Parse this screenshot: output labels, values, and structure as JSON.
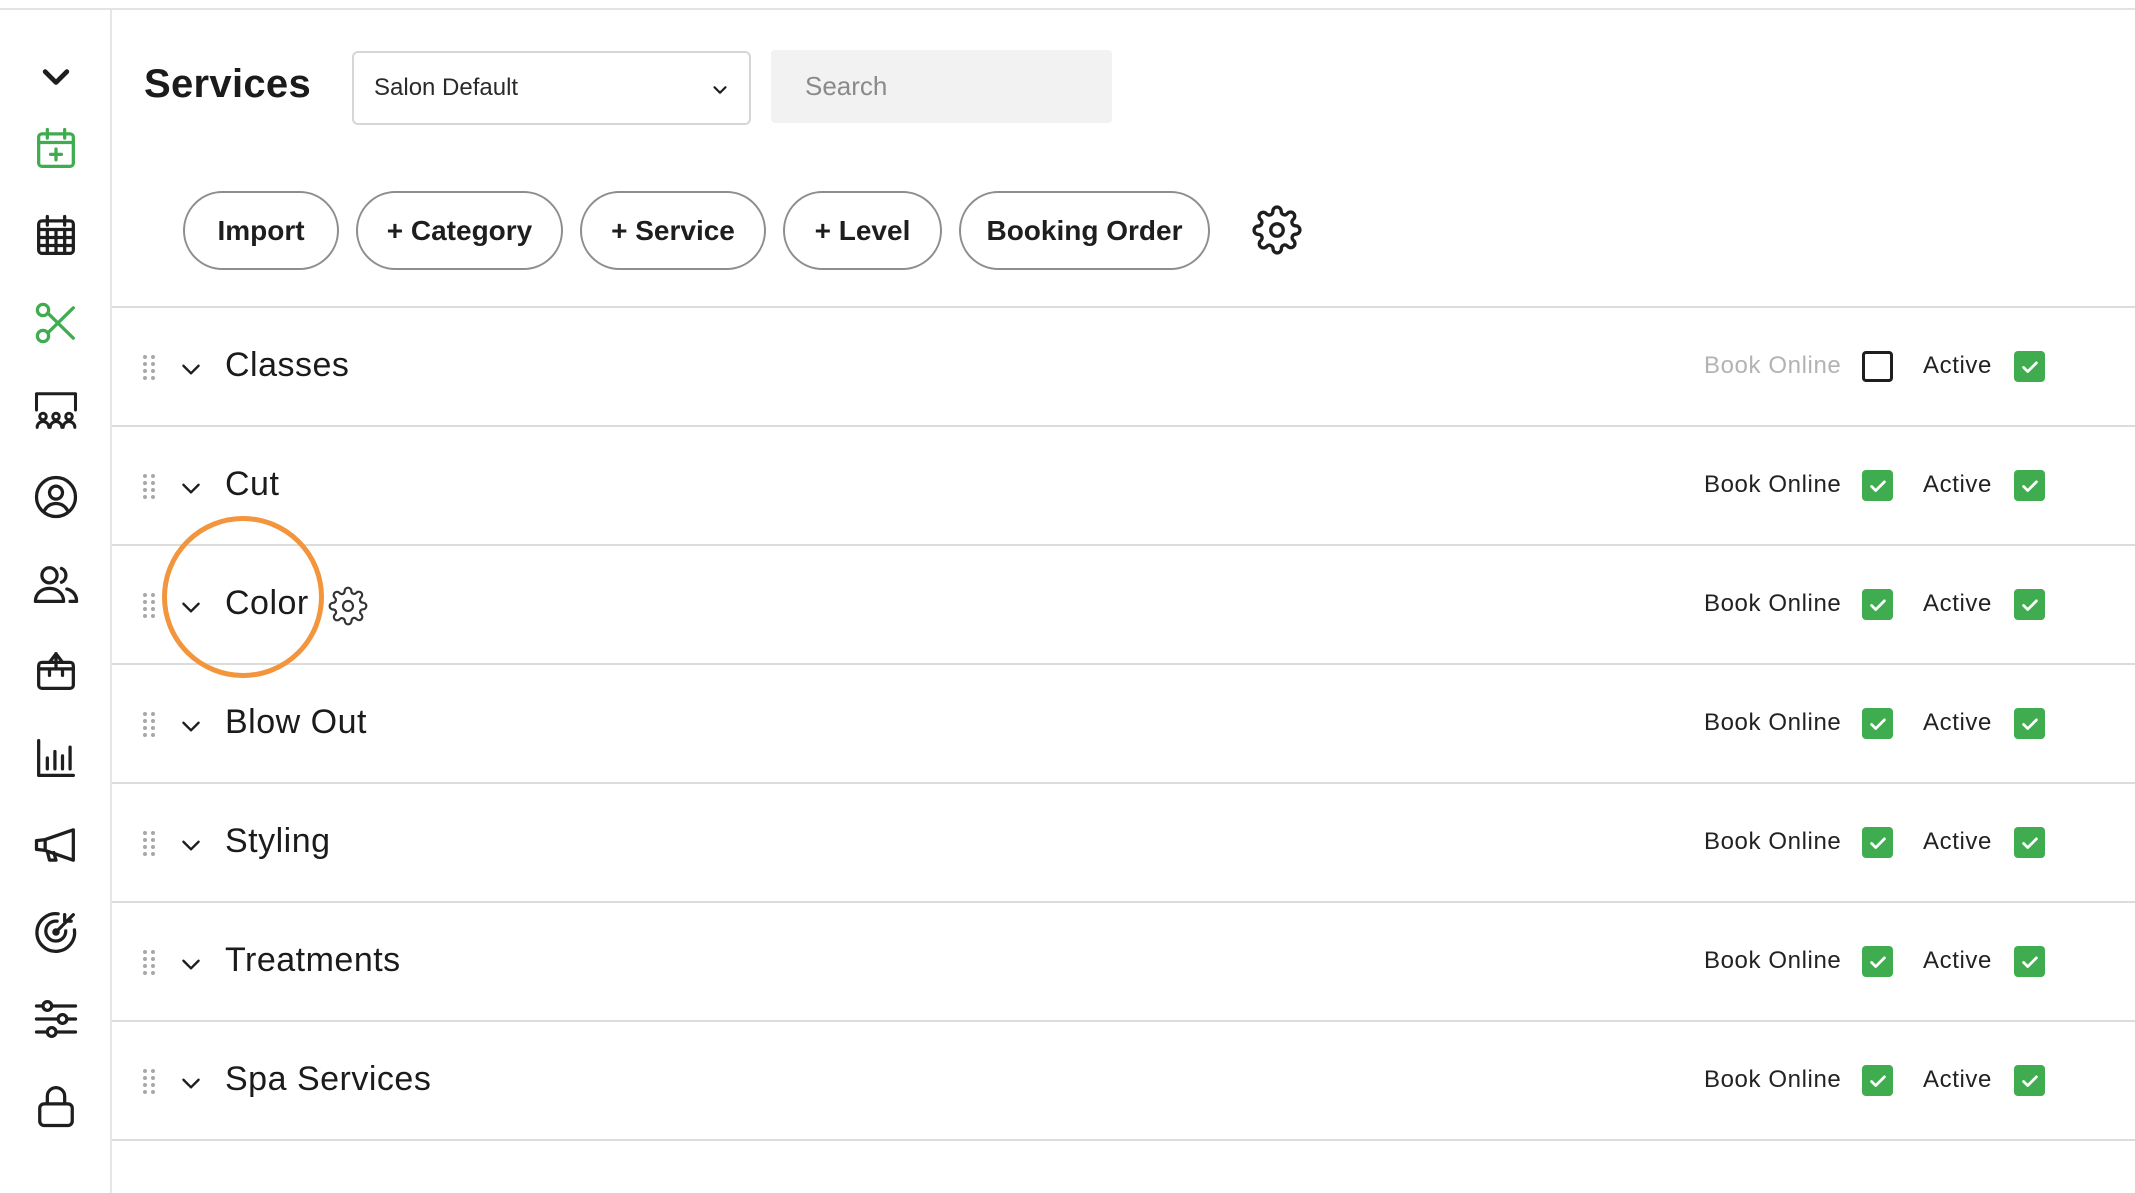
{
  "page": {
    "title": "Services"
  },
  "filter": {
    "selected": "Salon Default"
  },
  "search": {
    "placeholder": "Search",
    "value": ""
  },
  "toolbar": {
    "import_label": "Import",
    "category_label": "+ Category",
    "service_label": "+ Service",
    "level_label": "+ Level",
    "booking_order_label": "Booking Order"
  },
  "sidebar": {
    "items": [
      {
        "icon": "chevron-down-icon"
      },
      {
        "icon": "calendar-add-icon",
        "active": true
      },
      {
        "icon": "calendar-grid-icon"
      },
      {
        "icon": "scissors-icon",
        "active": true
      },
      {
        "icon": "team-board-icon"
      },
      {
        "icon": "user-circle-icon"
      },
      {
        "icon": "users-icon"
      },
      {
        "icon": "product-box-icon"
      },
      {
        "icon": "bar-chart-icon"
      },
      {
        "icon": "megaphone-icon"
      },
      {
        "icon": "target-icon"
      },
      {
        "icon": "sliders-icon"
      },
      {
        "icon": "lock-icon"
      }
    ]
  },
  "labels": {
    "book_online": "Book Online",
    "active": "Active"
  },
  "categories": [
    {
      "name": "Classes",
      "book_online": false,
      "active": true
    },
    {
      "name": "Cut",
      "book_online": true,
      "active": true
    },
    {
      "name": "Color",
      "book_online": true,
      "active": true,
      "highlighted": true
    },
    {
      "name": "Blow Out",
      "book_online": true,
      "active": true
    },
    {
      "name": "Styling",
      "book_online": true,
      "active": true
    },
    {
      "name": "Treatments",
      "book_online": true,
      "active": true
    },
    {
      "name": "Spa Services",
      "book_online": true,
      "active": true
    }
  ],
  "colors": {
    "accent_green": "#3fac4f",
    "highlight_orange": "#f3953c",
    "muted_label": "#b3b3b3"
  }
}
